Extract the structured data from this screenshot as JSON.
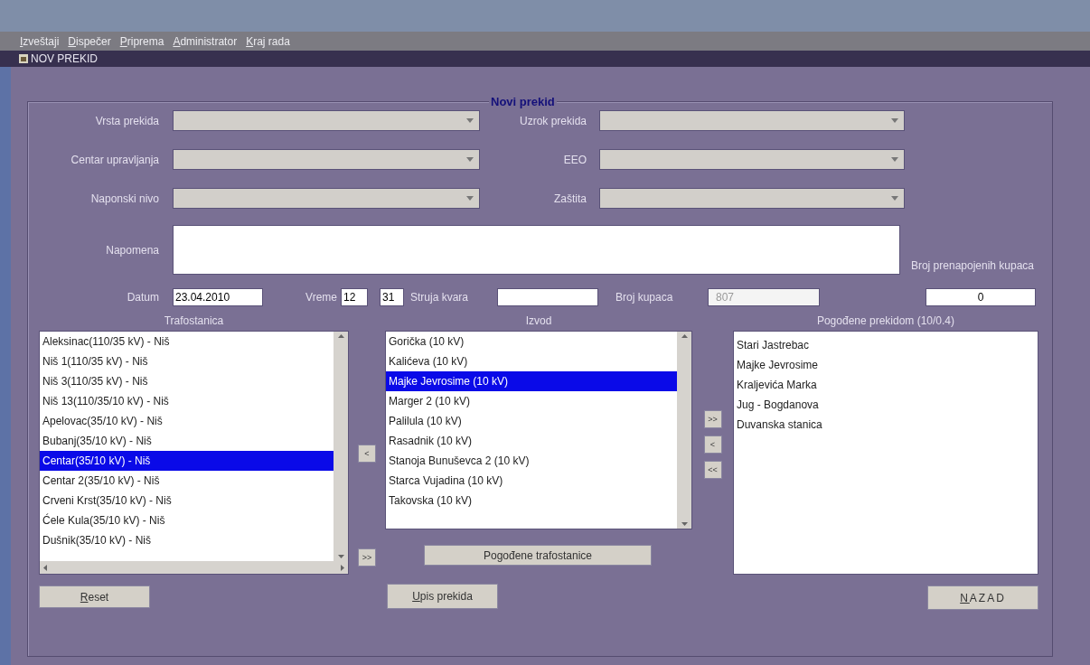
{
  "menu": [
    {
      "label": "Izveštaji"
    },
    {
      "label": "Dispečer"
    },
    {
      "label": "Priprema"
    },
    {
      "label": "Administrator"
    },
    {
      "label": "Kraj rada"
    }
  ],
  "window": {
    "title": "NOV PREKID"
  },
  "form": {
    "title": "Novi prekid",
    "combos": [
      {
        "label": "Vrsta prekida"
      },
      {
        "label": "Uzrok prekida"
      },
      {
        "label": "Centar upravljanja"
      },
      {
        "label": "EEO"
      },
      {
        "label": "Naponski nivo"
      },
      {
        "label": "Zaštita"
      }
    ],
    "note": {
      "label": "Napomena"
    },
    "date": {
      "label": "Datum",
      "value": "23.04.2010"
    },
    "time": {
      "label": "Vreme",
      "hours": "12",
      "minutes": "31"
    },
    "current": {
      "label": "Struja kvara"
    },
    "customers": {
      "label": "Broj kupaca",
      "value": "807",
      "disabled": true
    },
    "rerouted": {
      "label": "Broj prenapojenih kupaca",
      "value": "0"
    }
  },
  "substations": {
    "title": "Trafostanica",
    "items": [
      {
        "label": "Aleksinac(110/35 kV) - Niš",
        "selected": false
      },
      {
        "label": "Niš 1(110/35 kV) - Niš",
        "selected": false
      },
      {
        "label": "Niš 3(110/35 kV) - Niš",
        "selected": false
      },
      {
        "label": "Niš 13(110/35/10 kV) - Niš",
        "selected": false
      },
      {
        "label": "Apelovac(35/10 kV) - Niš",
        "selected": false
      },
      {
        "label": "Bubanj(35/10 kV) - Niš",
        "selected": false
      },
      {
        "label": "Centar(35/10 kV) - Niš",
        "selected": true
      },
      {
        "label": "Centar 2(35/10 kV) - Niš",
        "selected": false
      },
      {
        "label": "Crveni Krst(35/10 kV) - Niš",
        "selected": false
      },
      {
        "label": "Ćele Kula(35/10 kV) - Niš",
        "selected": false
      },
      {
        "label": "Dušnik(35/10 kV) - Niš",
        "selected": false
      }
    ]
  },
  "feeders": {
    "title": "Izvod",
    "items": [
      {
        "label": "Gorička (10 kV)",
        "selected": false
      },
      {
        "label": "Kalićeva (10 kV)",
        "selected": false
      },
      {
        "label": "Majke Jevrosime (10 kV)",
        "selected": true
      },
      {
        "label": "Marger 2 (10 kV)",
        "selected": false
      },
      {
        "label": "Palilula (10 kV)",
        "selected": false
      },
      {
        "label": "Rasadnik (10 kV)",
        "selected": false
      },
      {
        "label": "Stanoja Bunuševca 2 (10 kV)",
        "selected": false
      },
      {
        "label": "Starca Vujadina (10 kV)",
        "selected": false
      },
      {
        "label": "Takovska (10 kV)",
        "selected": false
      }
    ]
  },
  "affected": {
    "title": "Pogođene prekidom (10/0.4)",
    "items": [
      {
        "label": "Stari Jastrebac",
        "selected": false
      },
      {
        "label": "Majke Jevrosime",
        "selected": false
      },
      {
        "label": "Kraljevića Marka",
        "selected": false
      },
      {
        "label": "Jug - Bogdanova",
        "selected": false
      },
      {
        "label": "Duvanska stanica",
        "selected": false
      }
    ]
  },
  "left_buttons": [
    "<",
    ">>"
  ],
  "right_buttons": [
    ">>",
    "<",
    "<<"
  ],
  "affected_substations_button": "Pogođene trafostanice",
  "buttons": {
    "reset": "Reset",
    "save": "Upis prekida",
    "back": "NAZAD"
  }
}
